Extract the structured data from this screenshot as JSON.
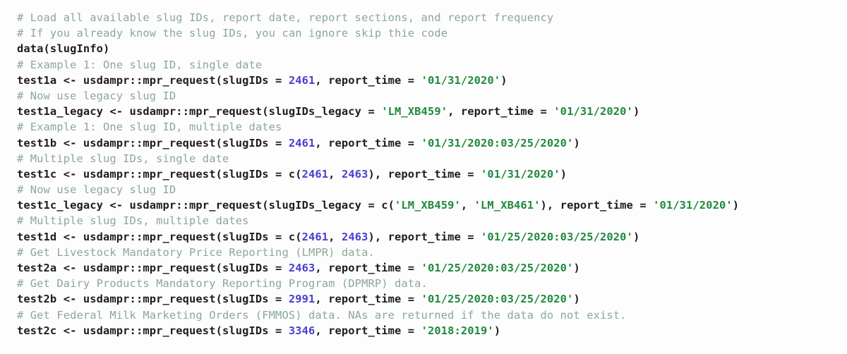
{
  "editor": {
    "language": "R",
    "background_color": "#fdfdfd",
    "comment_color": "#8aa79b",
    "code_color": "#1d1d1d",
    "number_color": "#4a3fd0",
    "string_color": "#1f8a3c"
  },
  "code": {
    "lines": [
      {
        "type": "comment",
        "text": "# Load all available slug IDs, report date, report sections, and report frequency"
      },
      {
        "type": "comment",
        "text": "# If you already know the slug IDs, you can ignore skip thie code"
      },
      {
        "type": "code",
        "tokens": [
          {
            "t": "plain",
            "v": "data(slugInfo)"
          }
        ]
      },
      {
        "type": "comment",
        "text": "# Example 1: One slug ID, single date"
      },
      {
        "type": "code",
        "tokens": [
          {
            "t": "plain",
            "v": "test1a <- usdampr::mpr_request(slugIDs = "
          },
          {
            "t": "num",
            "v": "2461"
          },
          {
            "t": "plain",
            "v": ", report_time = "
          },
          {
            "t": "str",
            "v": "'01/31/2020'"
          },
          {
            "t": "plain",
            "v": ")"
          }
        ]
      },
      {
        "type": "comment",
        "text": "# Now use legacy slug ID"
      },
      {
        "type": "code",
        "tokens": [
          {
            "t": "plain",
            "v": "test1a_legacy <- usdampr::mpr_request(slugIDs_legacy = "
          },
          {
            "t": "str",
            "v": "'LM_XB459'"
          },
          {
            "t": "plain",
            "v": ", report_time = "
          },
          {
            "t": "str",
            "v": "'01/31/2020'"
          },
          {
            "t": "plain",
            "v": ")"
          }
        ]
      },
      {
        "type": "comment",
        "text": "# Example 1: One slug ID, multiple dates"
      },
      {
        "type": "code",
        "tokens": [
          {
            "t": "plain",
            "v": "test1b <- usdampr::mpr_request(slugIDs = "
          },
          {
            "t": "num",
            "v": "2461"
          },
          {
            "t": "plain",
            "v": ", report_time = "
          },
          {
            "t": "str",
            "v": "'01/31/2020:03/25/2020'"
          },
          {
            "t": "plain",
            "v": ")"
          }
        ]
      },
      {
        "type": "comment",
        "text": "# Multiple slug IDs, single date"
      },
      {
        "type": "code",
        "tokens": [
          {
            "t": "plain",
            "v": "test1c <- usdampr::mpr_request(slugIDs = c("
          },
          {
            "t": "num",
            "v": "2461"
          },
          {
            "t": "plain",
            "v": ", "
          },
          {
            "t": "num",
            "v": "2463"
          },
          {
            "t": "plain",
            "v": "), report_time = "
          },
          {
            "t": "str",
            "v": "'01/31/2020'"
          },
          {
            "t": "plain",
            "v": ")"
          }
        ]
      },
      {
        "type": "comment",
        "text": "# Now use legacy slug ID"
      },
      {
        "type": "code",
        "tokens": [
          {
            "t": "plain",
            "v": "test1c_legacy <- usdampr::mpr_request(slugIDs_legacy = c("
          },
          {
            "t": "str",
            "v": "'LM_XB459'"
          },
          {
            "t": "plain",
            "v": ", "
          },
          {
            "t": "str",
            "v": "'LM_XB461'"
          },
          {
            "t": "plain",
            "v": "), report_time = "
          },
          {
            "t": "str",
            "v": "'01/31/2020'"
          },
          {
            "t": "plain",
            "v": ")"
          }
        ]
      },
      {
        "type": "comment",
        "text": "# Multiple slug IDs, multiple dates"
      },
      {
        "type": "code",
        "tokens": [
          {
            "t": "plain",
            "v": "test1d <- usdampr::mpr_request(slugIDs = c("
          },
          {
            "t": "num",
            "v": "2461"
          },
          {
            "t": "plain",
            "v": ", "
          },
          {
            "t": "num",
            "v": "2463"
          },
          {
            "t": "plain",
            "v": "), report_time = "
          },
          {
            "t": "str",
            "v": "'01/25/2020:03/25/2020'"
          },
          {
            "t": "plain",
            "v": ")"
          }
        ]
      },
      {
        "type": "comment",
        "text": "# Get Livestock Mandatory Price Reporting (LMPR) data."
      },
      {
        "type": "code",
        "tokens": [
          {
            "t": "plain",
            "v": "test2a <- usdampr::mpr_request(slugIDs = "
          },
          {
            "t": "num",
            "v": "2463"
          },
          {
            "t": "plain",
            "v": ", report_time = "
          },
          {
            "t": "str",
            "v": "'01/25/2020:03/25/2020'"
          },
          {
            "t": "plain",
            "v": ")"
          }
        ]
      },
      {
        "type": "comment",
        "text": "# Get Dairy Products Mandatory Reporting Program (DPMRP) data."
      },
      {
        "type": "code",
        "tokens": [
          {
            "t": "plain",
            "v": "test2b <- usdampr::mpr_request(slugIDs = "
          },
          {
            "t": "num",
            "v": "2991"
          },
          {
            "t": "plain",
            "v": ", report_time = "
          },
          {
            "t": "str",
            "v": "'01/25/2020:03/25/2020'"
          },
          {
            "t": "plain",
            "v": ")"
          }
        ]
      },
      {
        "type": "comment",
        "text": "# Get Federal Milk Marketing Orders (FMMOS) data. NAs are returned if the data do not exist."
      },
      {
        "type": "code",
        "tokens": [
          {
            "t": "plain",
            "v": "test2c <- usdampr::mpr_request(slugIDs = "
          },
          {
            "t": "num",
            "v": "3346"
          },
          {
            "t": "plain",
            "v": ", report_time = "
          },
          {
            "t": "str",
            "v": "'2018:2019'"
          },
          {
            "t": "plain",
            "v": ")"
          }
        ]
      }
    ]
  }
}
